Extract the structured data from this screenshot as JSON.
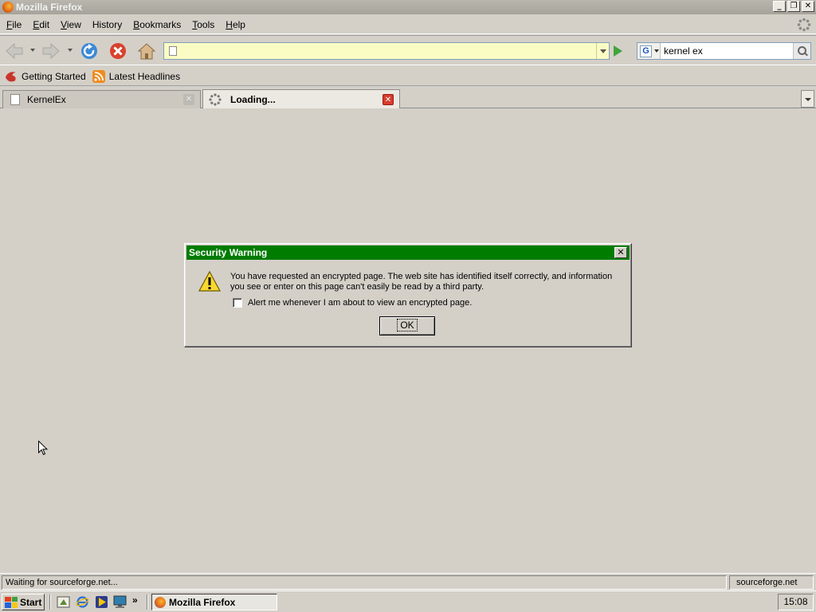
{
  "window": {
    "title": "Mozilla Firefox",
    "buttons": {
      "minimize": "_",
      "maximize": "❐",
      "close": "✕"
    }
  },
  "menu": [
    {
      "accel": "F",
      "rest": "ile"
    },
    {
      "accel": "E",
      "rest": "dit"
    },
    {
      "accel": "V",
      "rest": "iew"
    },
    {
      "accel": "",
      "rest": "History"
    },
    {
      "accel": "B",
      "rest": "ookmarks"
    },
    {
      "accel": "T",
      "rest": "ools"
    },
    {
      "accel": "H",
      "rest": "elp"
    }
  ],
  "navigation": {
    "url": "",
    "search_engine": "G",
    "search_query": "kernel ex"
  },
  "bookmarks": [
    {
      "label": "Getting Started",
      "icon": "firefox-bookmark-icon"
    },
    {
      "label": "Latest Headlines",
      "icon": "rss-feed-icon"
    }
  ],
  "tabs": [
    {
      "label": "KernelEx",
      "active": false
    },
    {
      "label": "Loading...",
      "active": true
    }
  ],
  "dialog": {
    "title": "Security Warning",
    "message": "You have requested an encrypted page. The web site has identified itself correctly, and information you see or enter on this page can't easily be read by a third party.",
    "checkbox_label": "Alert me whenever I am about to view an encrypted page.",
    "checkbox_checked": false,
    "ok_label": "OK",
    "close_glyph": "✕"
  },
  "status": {
    "text": "Waiting for sourceforge.net...",
    "host": "sourceforge.net"
  },
  "taskbar": {
    "start_label": "Start",
    "more": "»",
    "task_label": "Mozilla Firefox",
    "clock": "15:08"
  },
  "colors": {
    "dialog_title_bg": "#007c00",
    "url_bar_bg": "#fbfcc4",
    "chrome_bg": "#d4d0c8"
  }
}
